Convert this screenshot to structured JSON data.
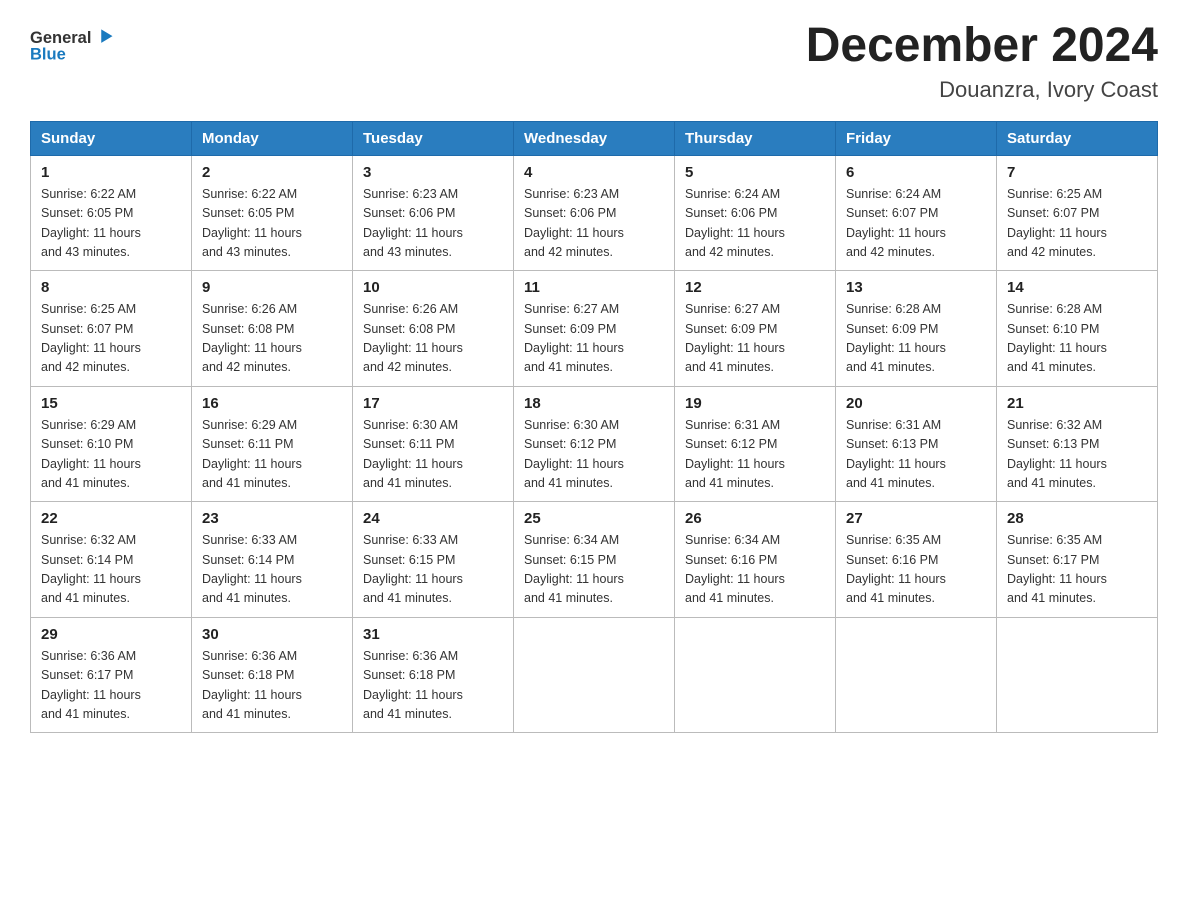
{
  "logo": {
    "text_general": "General",
    "text_blue": "Blue"
  },
  "header": {
    "month": "December 2024",
    "location": "Douanzra, Ivory Coast"
  },
  "days_of_week": [
    "Sunday",
    "Monday",
    "Tuesday",
    "Wednesday",
    "Thursday",
    "Friday",
    "Saturday"
  ],
  "weeks": [
    [
      {
        "day": "1",
        "sunrise": "6:22 AM",
        "sunset": "6:05 PM",
        "daylight": "11 hours and 43 minutes."
      },
      {
        "day": "2",
        "sunrise": "6:22 AM",
        "sunset": "6:05 PM",
        "daylight": "11 hours and 43 minutes."
      },
      {
        "day": "3",
        "sunrise": "6:23 AM",
        "sunset": "6:06 PM",
        "daylight": "11 hours and 43 minutes."
      },
      {
        "day": "4",
        "sunrise": "6:23 AM",
        "sunset": "6:06 PM",
        "daylight": "11 hours and 42 minutes."
      },
      {
        "day": "5",
        "sunrise": "6:24 AM",
        "sunset": "6:06 PM",
        "daylight": "11 hours and 42 minutes."
      },
      {
        "day": "6",
        "sunrise": "6:24 AM",
        "sunset": "6:07 PM",
        "daylight": "11 hours and 42 minutes."
      },
      {
        "day": "7",
        "sunrise": "6:25 AM",
        "sunset": "6:07 PM",
        "daylight": "11 hours and 42 minutes."
      }
    ],
    [
      {
        "day": "8",
        "sunrise": "6:25 AM",
        "sunset": "6:07 PM",
        "daylight": "11 hours and 42 minutes."
      },
      {
        "day": "9",
        "sunrise": "6:26 AM",
        "sunset": "6:08 PM",
        "daylight": "11 hours and 42 minutes."
      },
      {
        "day": "10",
        "sunrise": "6:26 AM",
        "sunset": "6:08 PM",
        "daylight": "11 hours and 42 minutes."
      },
      {
        "day": "11",
        "sunrise": "6:27 AM",
        "sunset": "6:09 PM",
        "daylight": "11 hours and 41 minutes."
      },
      {
        "day": "12",
        "sunrise": "6:27 AM",
        "sunset": "6:09 PM",
        "daylight": "11 hours and 41 minutes."
      },
      {
        "day": "13",
        "sunrise": "6:28 AM",
        "sunset": "6:09 PM",
        "daylight": "11 hours and 41 minutes."
      },
      {
        "day": "14",
        "sunrise": "6:28 AM",
        "sunset": "6:10 PM",
        "daylight": "11 hours and 41 minutes."
      }
    ],
    [
      {
        "day": "15",
        "sunrise": "6:29 AM",
        "sunset": "6:10 PM",
        "daylight": "11 hours and 41 minutes."
      },
      {
        "day": "16",
        "sunrise": "6:29 AM",
        "sunset": "6:11 PM",
        "daylight": "11 hours and 41 minutes."
      },
      {
        "day": "17",
        "sunrise": "6:30 AM",
        "sunset": "6:11 PM",
        "daylight": "11 hours and 41 minutes."
      },
      {
        "day": "18",
        "sunrise": "6:30 AM",
        "sunset": "6:12 PM",
        "daylight": "11 hours and 41 minutes."
      },
      {
        "day": "19",
        "sunrise": "6:31 AM",
        "sunset": "6:12 PM",
        "daylight": "11 hours and 41 minutes."
      },
      {
        "day": "20",
        "sunrise": "6:31 AM",
        "sunset": "6:13 PM",
        "daylight": "11 hours and 41 minutes."
      },
      {
        "day": "21",
        "sunrise": "6:32 AM",
        "sunset": "6:13 PM",
        "daylight": "11 hours and 41 minutes."
      }
    ],
    [
      {
        "day": "22",
        "sunrise": "6:32 AM",
        "sunset": "6:14 PM",
        "daylight": "11 hours and 41 minutes."
      },
      {
        "day": "23",
        "sunrise": "6:33 AM",
        "sunset": "6:14 PM",
        "daylight": "11 hours and 41 minutes."
      },
      {
        "day": "24",
        "sunrise": "6:33 AM",
        "sunset": "6:15 PM",
        "daylight": "11 hours and 41 minutes."
      },
      {
        "day": "25",
        "sunrise": "6:34 AM",
        "sunset": "6:15 PM",
        "daylight": "11 hours and 41 minutes."
      },
      {
        "day": "26",
        "sunrise": "6:34 AM",
        "sunset": "6:16 PM",
        "daylight": "11 hours and 41 minutes."
      },
      {
        "day": "27",
        "sunrise": "6:35 AM",
        "sunset": "6:16 PM",
        "daylight": "11 hours and 41 minutes."
      },
      {
        "day": "28",
        "sunrise": "6:35 AM",
        "sunset": "6:17 PM",
        "daylight": "11 hours and 41 minutes."
      }
    ],
    [
      {
        "day": "29",
        "sunrise": "6:36 AM",
        "sunset": "6:17 PM",
        "daylight": "11 hours and 41 minutes."
      },
      {
        "day": "30",
        "sunrise": "6:36 AM",
        "sunset": "6:18 PM",
        "daylight": "11 hours and 41 minutes."
      },
      {
        "day": "31",
        "sunrise": "6:36 AM",
        "sunset": "6:18 PM",
        "daylight": "11 hours and 41 minutes."
      },
      null,
      null,
      null,
      null
    ]
  ],
  "labels": {
    "sunrise": "Sunrise:",
    "sunset": "Sunset:",
    "daylight": "Daylight:"
  }
}
